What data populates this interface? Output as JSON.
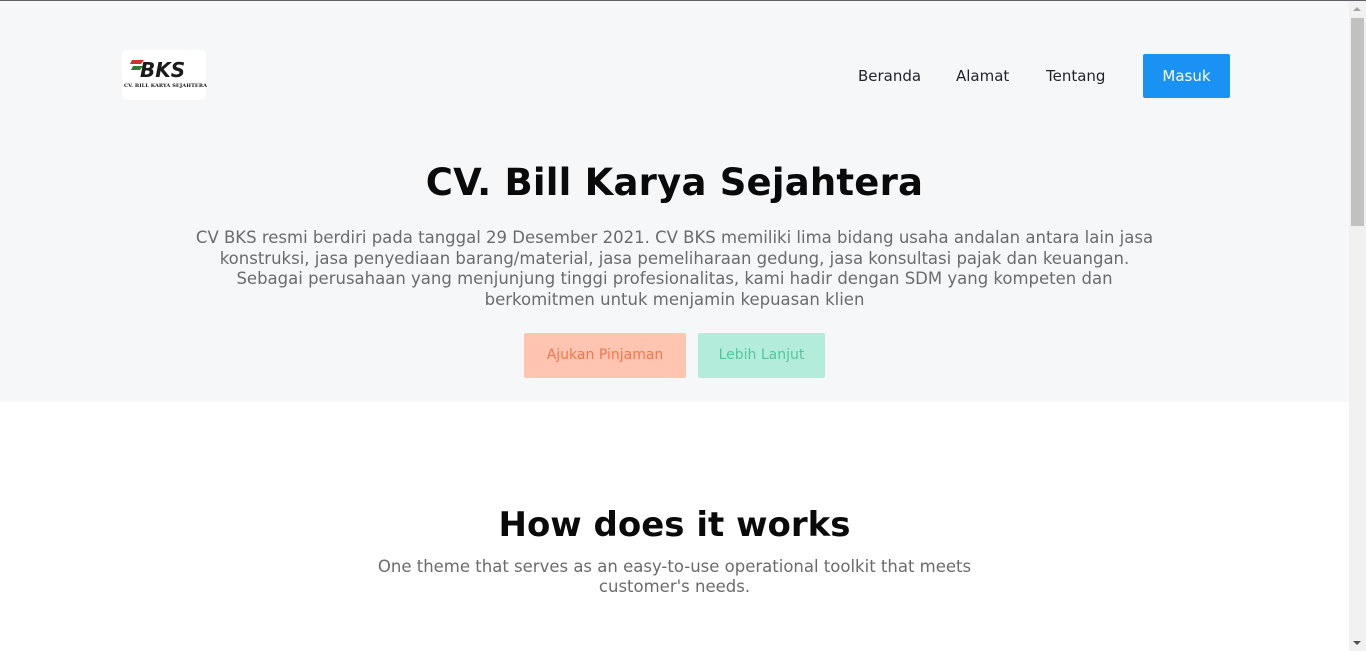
{
  "logo": {
    "mark": "BKS",
    "company_text": "CV. BILL KARYA SEJAHTERA"
  },
  "nav": {
    "items": [
      {
        "label": "Beranda"
      },
      {
        "label": "Alamat"
      },
      {
        "label": "Tentang"
      }
    ],
    "login_label": "Masuk"
  },
  "hero": {
    "title": "CV. Bill Karya Sejahtera",
    "description": "CV BKS resmi berdiri pada tanggal 29 Desember 2021. CV BKS memiliki lima bidang usaha andalan antara lain jasa konstruksi, jasa penyediaan barang/material, jasa pemeliharaan gedung, jasa konsultasi pajak dan keuangan. Sebagai perusahaan yang menjunjung tinggi profesionalitas, kami hadir dengan SDM yang kompeten dan berkomitmen untuk menjamin kepuasan klien",
    "primary_button": "Ajukan Pinjaman",
    "secondary_button": "Lebih Lanjut"
  },
  "how_it_works": {
    "title": "How does it works",
    "description": "One theme that serves as an easy-to-use operational toolkit that meets customer's needs."
  },
  "colors": {
    "hero_bg": "#f6f7f9",
    "login_button": "#1a92f4",
    "primary_button_bg": "#ffc5b0",
    "primary_button_text": "#f4754d",
    "secondary_button_bg": "#b4ecdb",
    "secondary_button_text": "#52c79c"
  },
  "icons": {
    "scroll_up": "chevron-up-icon",
    "scroll_down": "chevron-down-icon"
  }
}
